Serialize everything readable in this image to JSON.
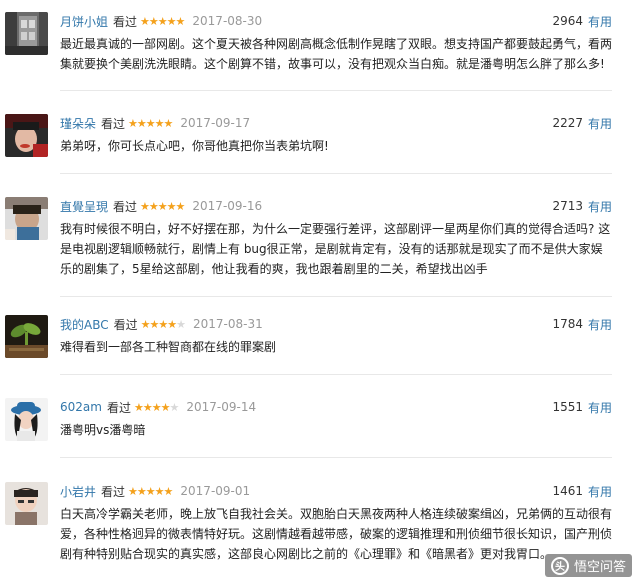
{
  "reviews": [
    {
      "user": "月饼小姐",
      "status": "看过",
      "rating": 5,
      "date": "2017-08-30",
      "count": "2964",
      "useful_label": "有用",
      "text": "最近最真诚的一部网剧。这个夏天被各种网剧高概念低制作晃瞎了双眼。想支持国产都要鼓起勇气，看两集就要换个美剧洗洗眼睛。这个剧算不错，故事可以，没有把观众当白痴。就是潘粤明怎么胖了那么多!"
    },
    {
      "user": "瑾朵朵",
      "status": "看过",
      "rating": 5,
      "date": "2017-09-17",
      "count": "2227",
      "useful_label": "有用",
      "text": "弟弟呀，你可长点心吧，你哥他真把你当表弟坑啊!"
    },
    {
      "user": "直覺呈現",
      "status": "看过",
      "rating": 5,
      "date": "2017-09-16",
      "count": "2713",
      "useful_label": "有用",
      "text": "我有时候很不明白，好不好摆在那，为什么一定要强行差评，这部剧评一星两星你们真的觉得合适吗? 这是电视剧逻辑顺畅就行，剧情上有 bug很正常，是剧就肯定有，没有的话那就是现实了而不是供大家娱乐的剧集了，5星给这部剧，他让我看的爽，我也跟着剧里的二关，希望找出凶手"
    },
    {
      "user": "我的ABC",
      "status": "看过",
      "rating": 4,
      "date": "2017-08-31",
      "count": "1784",
      "useful_label": "有用",
      "text": "难得看到一部各工种智商都在线的罪案剧"
    },
    {
      "user": "602am",
      "status": "看过",
      "rating": 4,
      "date": "2017-09-14",
      "count": "1551",
      "useful_label": "有用",
      "text": "潘粤明vs潘粤暗"
    },
    {
      "user": "小岩井",
      "status": "看过",
      "rating": 5,
      "date": "2017-09-01",
      "count": "1461",
      "useful_label": "有用",
      "text": "白天高冷学霸关老师，晚上放飞自我社会关。双胞胎白天黑夜两种人格连续破案缉凶，兄弟俩的互动很有爱，各种性格迥异的微表情特好玩。这剧情越看越带感，破案的逻辑推理和刑侦细节很长知识，国产刑侦剧有种特别贴合现实的真实感，这部良心网剧比之前的《心理罪》和《暗黑者》更对我胃口。"
    }
  ],
  "watermark": {
    "logo_char": "头",
    "text": "悟空问答"
  },
  "colors": {
    "link": "#3377aa",
    "star": "#f4a11c",
    "star_empty": "#d8d8d8",
    "date": "#999999",
    "divider": "#e8e8e8"
  }
}
